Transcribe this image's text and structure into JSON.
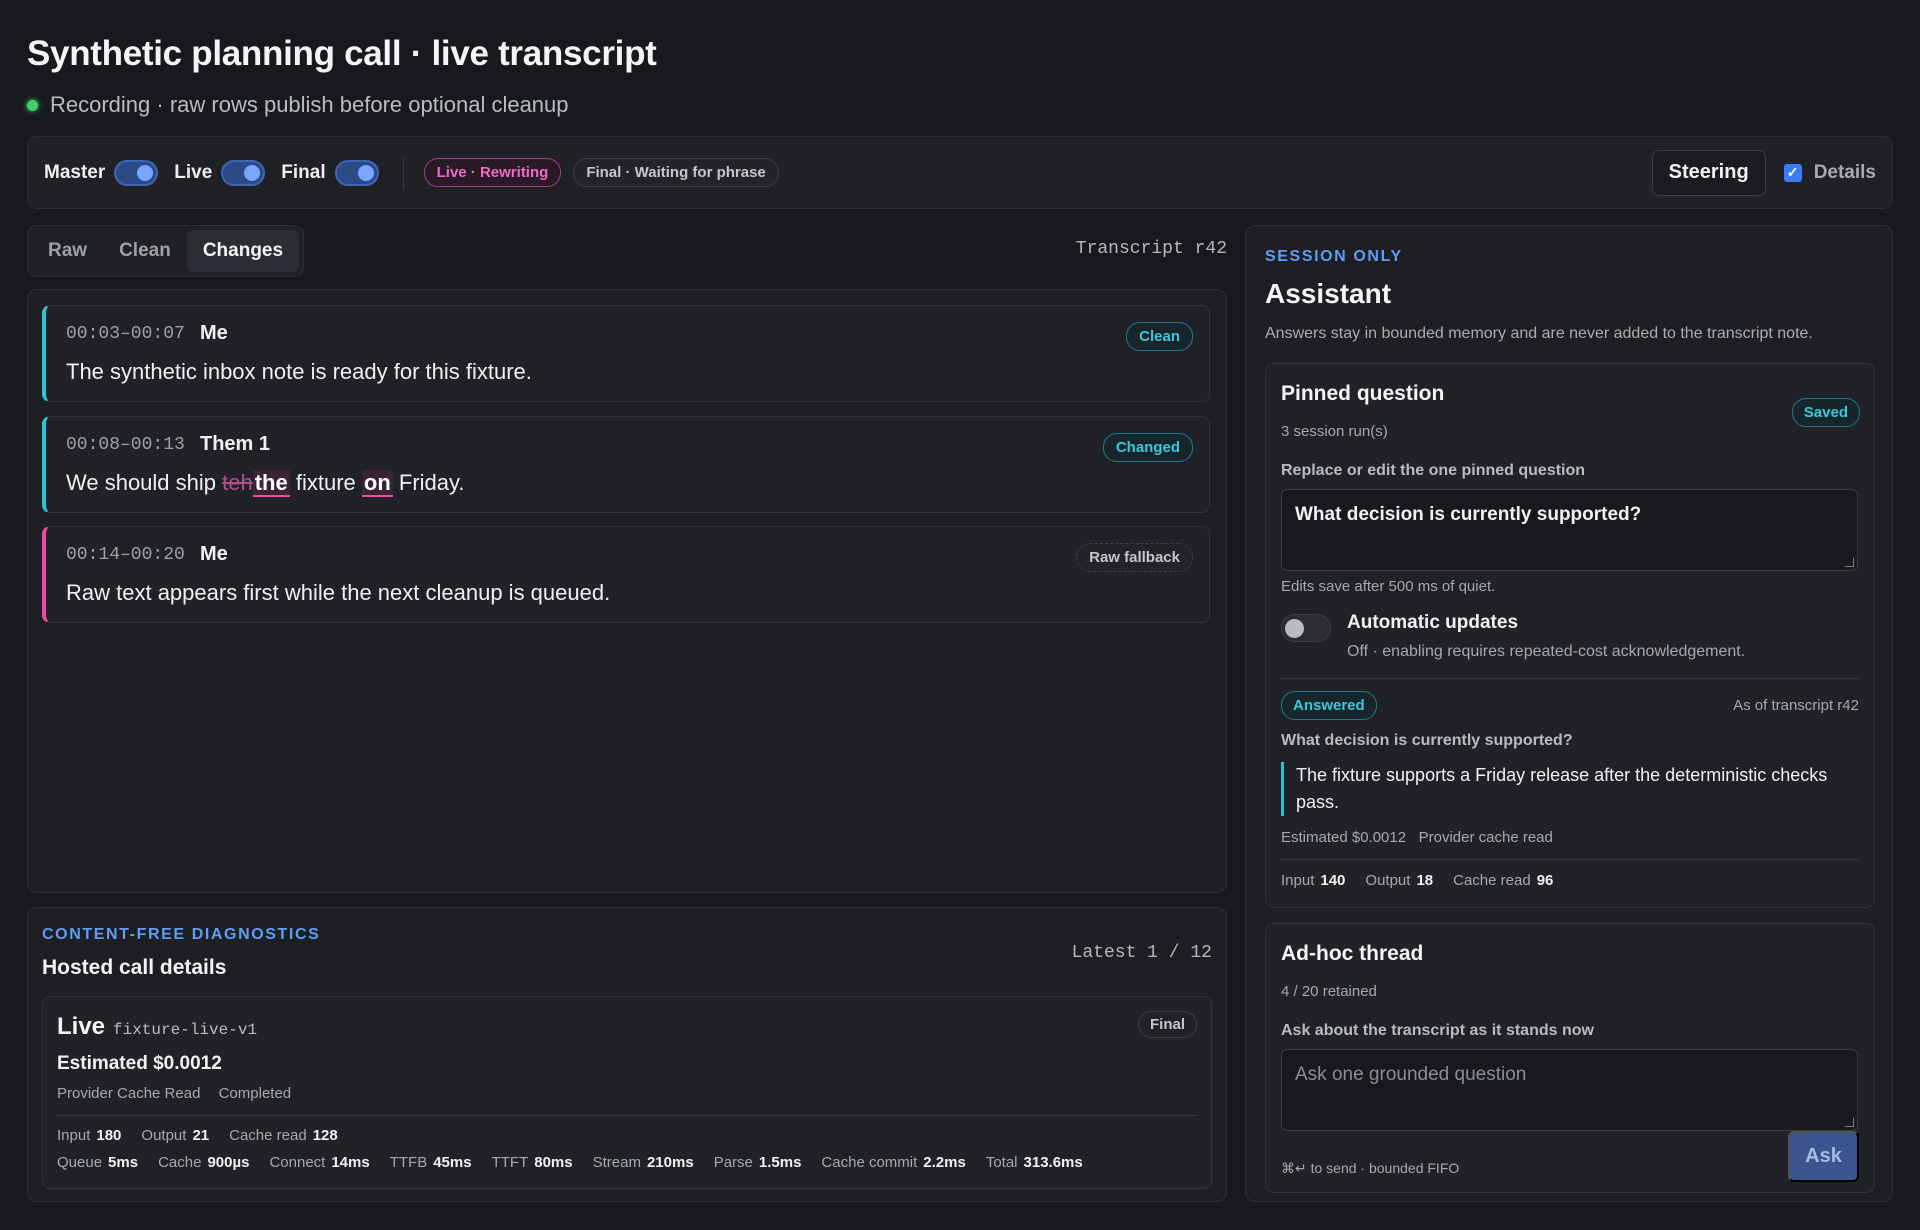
{
  "header": {
    "title": "Synthetic planning call · live transcript",
    "status": "Recording · raw rows publish before optional cleanup"
  },
  "toolbar": {
    "toggles": [
      {
        "label": "Master",
        "on": true
      },
      {
        "label": "Live",
        "on": true
      },
      {
        "label": "Final",
        "on": true
      }
    ],
    "live_pill": "Live · Rewriting",
    "final_pill": "Final · Waiting for phrase",
    "steering_label": "Steering",
    "details_label": "Details",
    "details_checked": true
  },
  "view_tabs": {
    "items": [
      "Raw",
      "Clean",
      "Changes"
    ],
    "active": "Changes",
    "revision": "Transcript r42"
  },
  "rows": [
    {
      "time": "00:03–00:07",
      "speaker": "Me",
      "text": "The synthetic inbox note is ready for this fixture.",
      "badge": "Clean"
    },
    {
      "time": "00:08–00:13",
      "speaker": "Them 1",
      "text_before": "We should ship ",
      "deleted": "teh",
      "inserted1": "the",
      "text_mid": " fixture ",
      "inserted2": "on",
      "text_after": " Friday.",
      "badge": "Changed"
    },
    {
      "time": "00:14–00:20",
      "speaker": "Me",
      "text": "Raw text appears first while the next cleanup is queued.",
      "badge": "Raw fallback"
    }
  ],
  "diagnostics": {
    "eyebrow": "CONTENT-FREE DIAGNOSTICS",
    "title": "Hosted call details",
    "latest": "Latest 1 / 12",
    "card": {
      "title": "Live",
      "model": "fixture-live-v1",
      "badge": "Final",
      "cost": "Estimated $0.0012",
      "tags": [
        "Provider Cache Read",
        "Completed"
      ],
      "tokens": [
        {
          "label": "Input",
          "value": "180"
        },
        {
          "label": "Output",
          "value": "21"
        },
        {
          "label": "Cache read",
          "value": "128"
        }
      ],
      "timings": [
        {
          "label": "Queue",
          "value": "5ms"
        },
        {
          "label": "Cache",
          "value": "900µs"
        },
        {
          "label": "Connect",
          "value": "14ms"
        },
        {
          "label": "TTFB",
          "value": "45ms"
        },
        {
          "label": "TTFT",
          "value": "80ms"
        },
        {
          "label": "Stream",
          "value": "210ms"
        },
        {
          "label": "Parse",
          "value": "1.5ms"
        },
        {
          "label": "Cache commit",
          "value": "2.2ms"
        },
        {
          "label": "Total",
          "value": "313.6ms"
        }
      ]
    }
  },
  "assistant": {
    "eyebrow": "SESSION ONLY",
    "title": "Assistant",
    "description": "Answers stay in bounded memory and are never added to the transcript note.",
    "pinned": {
      "title": "Pinned question",
      "runs": "3 session run(s)",
      "badge": "Saved",
      "field_label": "Replace or edit the one pinned question",
      "question": "What decision is currently supported?",
      "save_hint": "Edits save after 500 ms of quiet.",
      "auto_title": "Automatic updates",
      "auto_desc": "Off · enabling requires repeated-cost acknowledgement.",
      "auto_on": false,
      "answer_badge": "Answered",
      "as_of": "As of transcript r42",
      "answer_question": "What decision is currently supported?",
      "answer": "The fixture supports a Friday release after the deterministic checks pass.",
      "cost": "Estimated $0.0012",
      "cache": "Provider cache read",
      "tokens": [
        {
          "label": "Input",
          "value": "140"
        },
        {
          "label": "Output",
          "value": "18"
        },
        {
          "label": "Cache read",
          "value": "96"
        }
      ]
    },
    "adhoc": {
      "title": "Ad-hoc thread",
      "retained": "4 / 20 retained",
      "field_label": "Ask about the transcript as it stands now",
      "placeholder": "Ask one grounded question",
      "hint": "⌘↵ to send · bounded FIFO",
      "ask_label": "Ask"
    }
  }
}
